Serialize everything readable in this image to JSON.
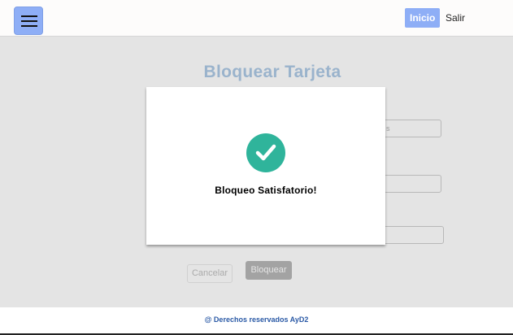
{
  "navbar": {
    "menu_icon": "hamburger-menu-icon",
    "links": [
      "Inicio",
      "Salir"
    ]
  },
  "page": {
    "title": "Bloquear Tarjeta",
    "field1_partial": "s",
    "cancel_label": "Cancelar",
    "block_label": "Bloquear"
  },
  "modal": {
    "icon": "check-circle-icon",
    "message": "Bloqueo Satisfatorio!",
    "accent_color": "#2fb49b"
  },
  "footer": {
    "text": "@ Derechos reservados AyD2"
  },
  "colors": {
    "primary": "#8eaef6",
    "title": "#9ab3cc"
  }
}
